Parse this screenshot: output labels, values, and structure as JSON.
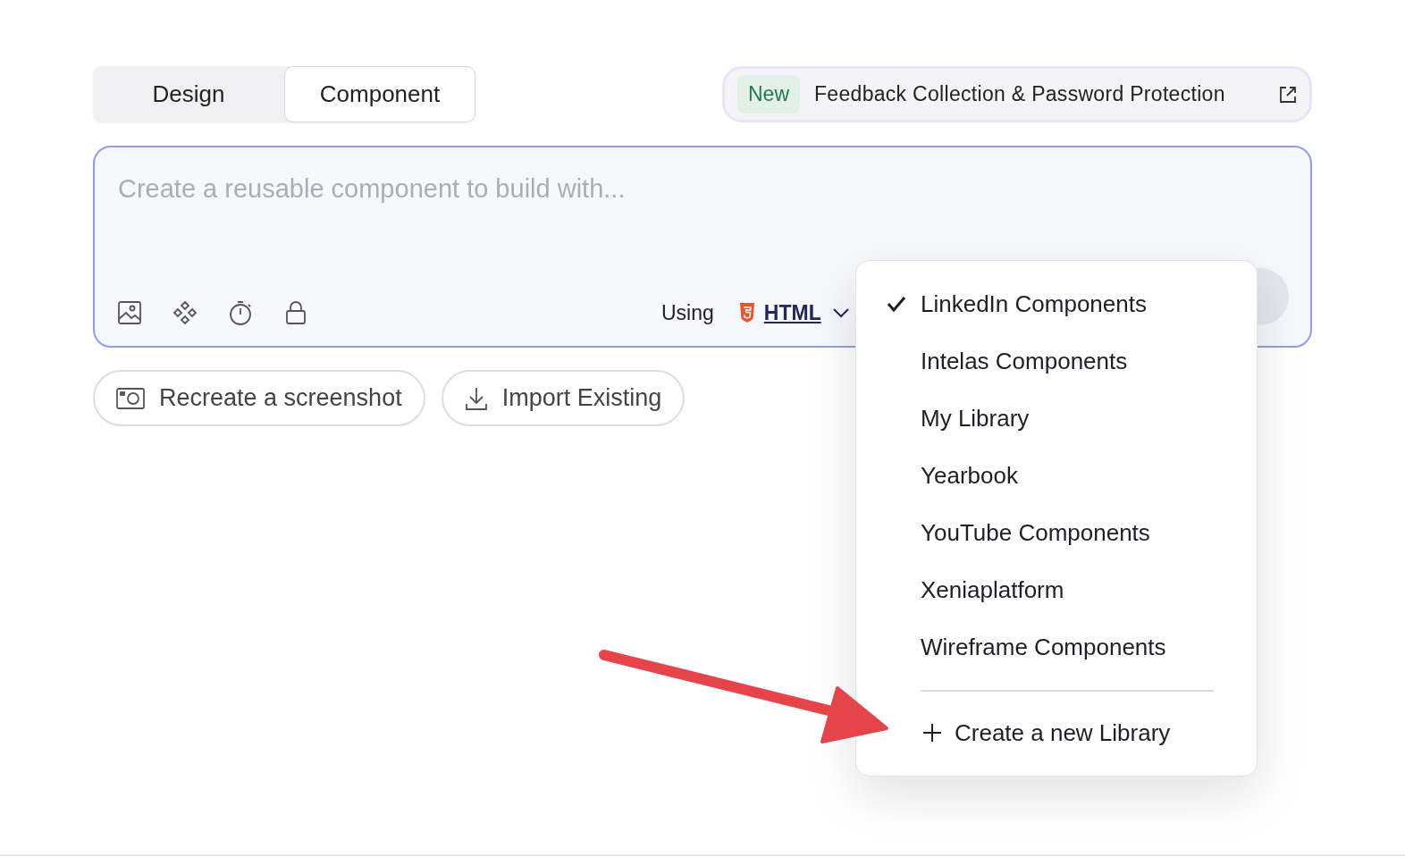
{
  "mode_tabs": [
    {
      "label": "Design",
      "selected": false
    },
    {
      "label": "Component",
      "selected": true
    }
  ],
  "announcement": {
    "badge": "New",
    "text": "Feedback Collection & Password Protection"
  },
  "prompt": {
    "placeholder": "Create a reusable component to build with...",
    "using_label": "Using",
    "framework": "HTML"
  },
  "actions": [
    {
      "kind": "screenshot",
      "label": "Recreate a screenshot"
    },
    {
      "kind": "import",
      "label": "Import Existing"
    }
  ],
  "library_menu": {
    "items": [
      {
        "label": "LinkedIn Components",
        "selected": true
      },
      {
        "label": "Intelas Components",
        "selected": false
      },
      {
        "label": "My Library",
        "selected": false
      },
      {
        "label": "Yearbook",
        "selected": false
      },
      {
        "label": "YouTube Components",
        "selected": false
      },
      {
        "label": "Xeniaplatform",
        "selected": false
      },
      {
        "label": "Wireframe Components",
        "selected": false
      }
    ],
    "create_label": "Create a new Library"
  }
}
